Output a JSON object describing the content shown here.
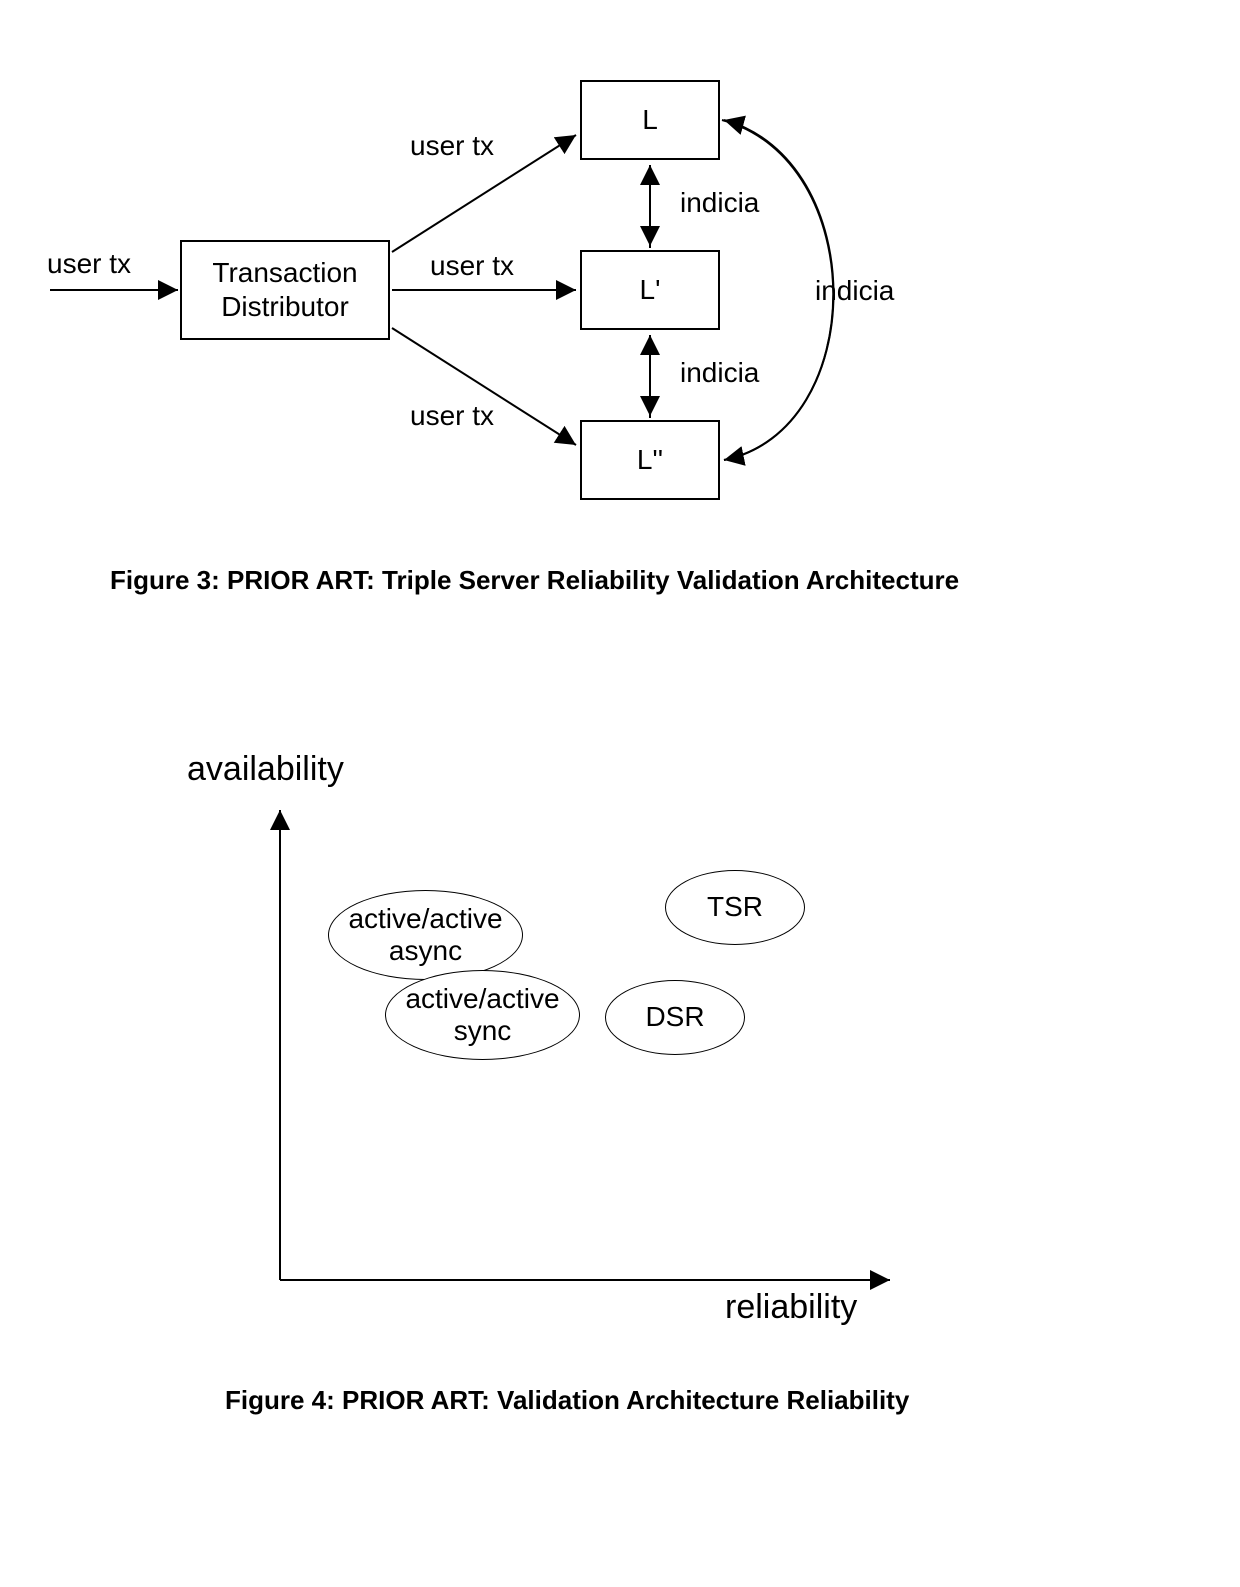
{
  "fig3": {
    "labels": {
      "user_tx_in": "user tx",
      "user_tx_top": "user tx",
      "user_tx_mid": "user tx",
      "user_tx_bot": "user tx",
      "indicia_top": "indicia",
      "indicia_mid": "indicia",
      "indicia_right": "indicia"
    },
    "boxes": {
      "distributor_line1": "Transaction",
      "distributor_line2": "Distributor",
      "L": "L",
      "Lp": "L'",
      "Lpp": "L''"
    },
    "caption": "Figure 3: PRIOR ART: Triple Server Reliability Validation Architecture"
  },
  "fig4": {
    "axes": {
      "y": "availability",
      "x": "reliability"
    },
    "ellipses": {
      "aa_async_line1": "active/active",
      "aa_async_line2": "async",
      "aa_sync_line1": "active/active",
      "aa_sync_line2": "sync",
      "tsr": "TSR",
      "dsr": "DSR"
    },
    "caption": "Figure 4: PRIOR ART: Validation Architecture Reliability"
  }
}
